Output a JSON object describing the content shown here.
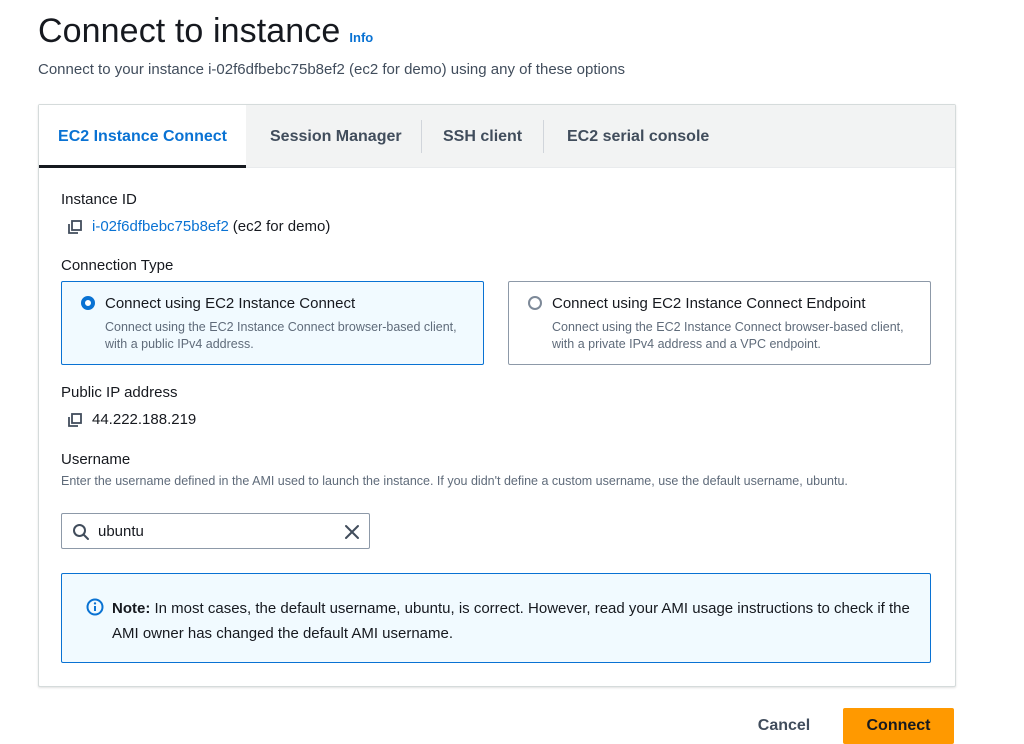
{
  "header": {
    "title": "Connect to instance",
    "info_link": "Info",
    "subtitle": "Connect to your instance i-02f6dfbebc75b8ef2 (ec2 for demo) using any of these options"
  },
  "tabs": [
    {
      "label": "EC2 Instance Connect",
      "active": true
    },
    {
      "label": "Session Manager",
      "active": false
    },
    {
      "label": "SSH client",
      "active": false
    },
    {
      "label": "EC2 serial console",
      "active": false
    }
  ],
  "instance": {
    "label": "Instance ID",
    "id": "i-02f6dfbebc75b8ef2",
    "name": "(ec2 for demo)"
  },
  "connection_type": {
    "label": "Connection Type",
    "options": [
      {
        "title": "Connect using EC2 Instance Connect",
        "description": "Connect using the EC2 Instance Connect browser-based client, with a public IPv4 address.",
        "selected": true
      },
      {
        "title": "Connect using EC2 Instance Connect Endpoint",
        "description": "Connect using the EC2 Instance Connect browser-based client, with a private IPv4 address and a VPC endpoint.",
        "selected": false
      }
    ]
  },
  "public_ip": {
    "label": "Public IP address",
    "value": "44.222.188.219"
  },
  "username": {
    "label": "Username",
    "help": "Enter the username defined in the AMI used to launch the instance. If you didn't define a custom username, use the default username, ubuntu.",
    "value": "ubuntu"
  },
  "alert": {
    "prefix": "Note:",
    "text": " In most cases, the default username, ubuntu, is correct. However, read your AMI usage instructions to check if the AMI owner has changed the default AMI username."
  },
  "actions": {
    "cancel": "Cancel",
    "connect": "Connect"
  },
  "colors": {
    "accent": "#0972d3",
    "primary_button": "#ff9900",
    "selected_bg": "#f1faff"
  },
  "icons": {
    "copy": "copy-icon",
    "search": "search-icon",
    "clear": "close-icon",
    "info": "info-icon"
  }
}
